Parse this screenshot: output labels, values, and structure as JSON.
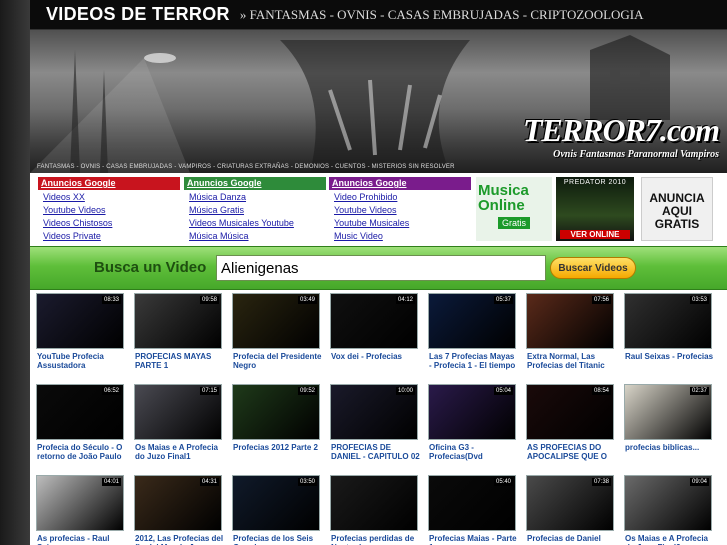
{
  "header": {
    "site_title": "VIDEOS DE TERROR",
    "nav": "» FANTASMAS - OVNIS - CASAS EMBRUJADAS - CRIPTOZOOLOGIA"
  },
  "banner": {
    "tagline": "FANTASMAS - OVNIS - CASAS EMBRUJADAS - VAMPIROS - CRIATURAS EXTRAÑAS - DEMONIOS - CUENTOS - MISTERIOS SIN RESOLVER",
    "logo_main": "TERROR7.com",
    "logo_sub": "Ovnis Fantasmas Paranormal Vampiros"
  },
  "ads": {
    "columns": [
      {
        "head": "Anuncios Google",
        "color": "#c8141e",
        "links": [
          "Videos XX",
          "Youtube Videos",
          "Videos Chistosos",
          "Videos Private"
        ]
      },
      {
        "head": "Anuncios Google",
        "color": "#2e8b3a",
        "links": [
          "Música Danza",
          "Música Gratis",
          "Videos Musicales Youtube",
          "Música Música"
        ]
      },
      {
        "head": "Anuncios Google",
        "color": "#7a1c8c",
        "links": [
          "Video Prohibido",
          "Youtube Videos",
          "Youtube Musicales",
          "Music Video"
        ]
      }
    ],
    "musica": {
      "line1": "Musica",
      "line2": "Online",
      "badge": "Gratis"
    },
    "predator": {
      "top": "PREDATOR 2010",
      "bottom": "VER ONLINE"
    },
    "anuncia": {
      "l1": "ANUNCIA",
      "l2": "AQUI",
      "l3": "GRATIS"
    }
  },
  "search": {
    "label": "Busca un Video",
    "value": "Alienigenas",
    "button": "Buscar Videos"
  },
  "videos": [
    {
      "title": "YouTube Profecia Assustadora",
      "duration": "08:33",
      "color": "#1b1b2e"
    },
    {
      "title": "PROFECIAS MAYAS PARTE 1",
      "duration": "09:58",
      "color": "#3a3a3a"
    },
    {
      "title": "Profecia del Presidente Negro",
      "duration": "03:49",
      "color": "#2a2510"
    },
    {
      "title": "Vox dei - Profecias",
      "duration": "04:12",
      "color": "#101010"
    },
    {
      "title": "Las 7 Profecias Mayas - Profecia 1 - El tiempo",
      "duration": "05:37",
      "color": "#0b1a3a"
    },
    {
      "title": "Extra Normal, Las Profecias del Titanic",
      "duration": "07:56",
      "color": "#5a2a1a"
    },
    {
      "title": "Raul Seixas - Profecias",
      "duration": "03:53",
      "color": "#303030"
    },
    {
      "title": "Profecia do Século - O retorno de João Paulo",
      "duration": "06:52",
      "color": "#0a0a0a"
    },
    {
      "title": "Os Maias e A Profecia do Juzo Final1",
      "duration": "07:15",
      "color": "#4a4a52"
    },
    {
      "title": "Profecias 2012 Parte 2",
      "duration": "09:52",
      "color": "#1f3a1a"
    },
    {
      "title": "PROFECIAS DE DANIEL - CAPITULO 02",
      "duration": "10:00",
      "color": "#1a1a2a"
    },
    {
      "title": "Oficina G3 - Profecias(Dvd",
      "duration": "05:04",
      "color": "#2a1a4a"
    },
    {
      "title": "AS PROFECIAS DO APOCALIPSE QUE O",
      "duration": "08:54",
      "color": "#1a0a0a"
    },
    {
      "title": "profecias biblicas...",
      "duration": "02:37",
      "color": "#d8d4c8"
    },
    {
      "title": "As profecias - Raul Seixas",
      "duration": "04:01",
      "color": "#bdbdbd"
    },
    {
      "title": "2012, Las Profecias del fin del Mundo Jose",
      "duration": "04:31",
      "color": "#3a2a1a"
    },
    {
      "title": "Profecias de los Seis Grandes",
      "duration": "03:50",
      "color": "#101a2a"
    },
    {
      "title": "Profecias perdidas de Nostradamus",
      "duration": "",
      "color": "#1a1a1a"
    },
    {
      "title": "Profecias Maias - Parte 1",
      "duration": "05:40",
      "color": "#0a0a0a"
    },
    {
      "title": "Profecias de Daniel",
      "duration": "07:38",
      "color": "#4a4a4a"
    },
    {
      "title": "Os Maias e A Profecia do Juzo Final2",
      "duration": "09:04",
      "color": "#6a6a6a"
    }
  ]
}
